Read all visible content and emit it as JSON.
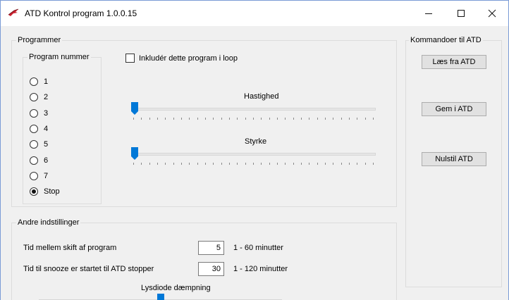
{
  "window": {
    "title": "ATD Kontrol program 1.0.0.15",
    "minimize_icon": "minimize-icon",
    "maximize_icon": "maximize-icon",
    "close_icon": "close-icon"
  },
  "programmer": {
    "group_title": "Programmer",
    "program_group": {
      "title": "Program nummer",
      "options": [
        "1",
        "2",
        "3",
        "4",
        "5",
        "6",
        "7",
        "Stop"
      ],
      "selected": "Stop"
    },
    "include_loop": {
      "label": "Inkludér dette program i loop",
      "checked": false
    },
    "hastighed": {
      "label": "Hastighed",
      "value_fraction": 0.0
    },
    "styrke": {
      "label": "Styrke",
      "value_fraction": 0.0
    }
  },
  "commands": {
    "group_title": "Kommandoer til ATD",
    "read_label": "Læs fra ATD",
    "save_label": "Gem i ATD",
    "reset_label": "Nulstil ATD"
  },
  "other": {
    "group_title": "Andre indstillinger",
    "interval": {
      "label": "Tid mellem skift af program",
      "value": "5",
      "range": "1 - 60 minutter"
    },
    "snooze": {
      "label": "Tid til snooze er startet til ATD stopper",
      "value": "30",
      "range": "1 - 120 minutter"
    },
    "led_dimming": {
      "label": "Lysdiode dæmpning",
      "value_fraction": 0.5
    }
  },
  "colors": {
    "accent": "#0078d7",
    "background": "#f0f0f0",
    "titlebar": "#ffffff"
  }
}
